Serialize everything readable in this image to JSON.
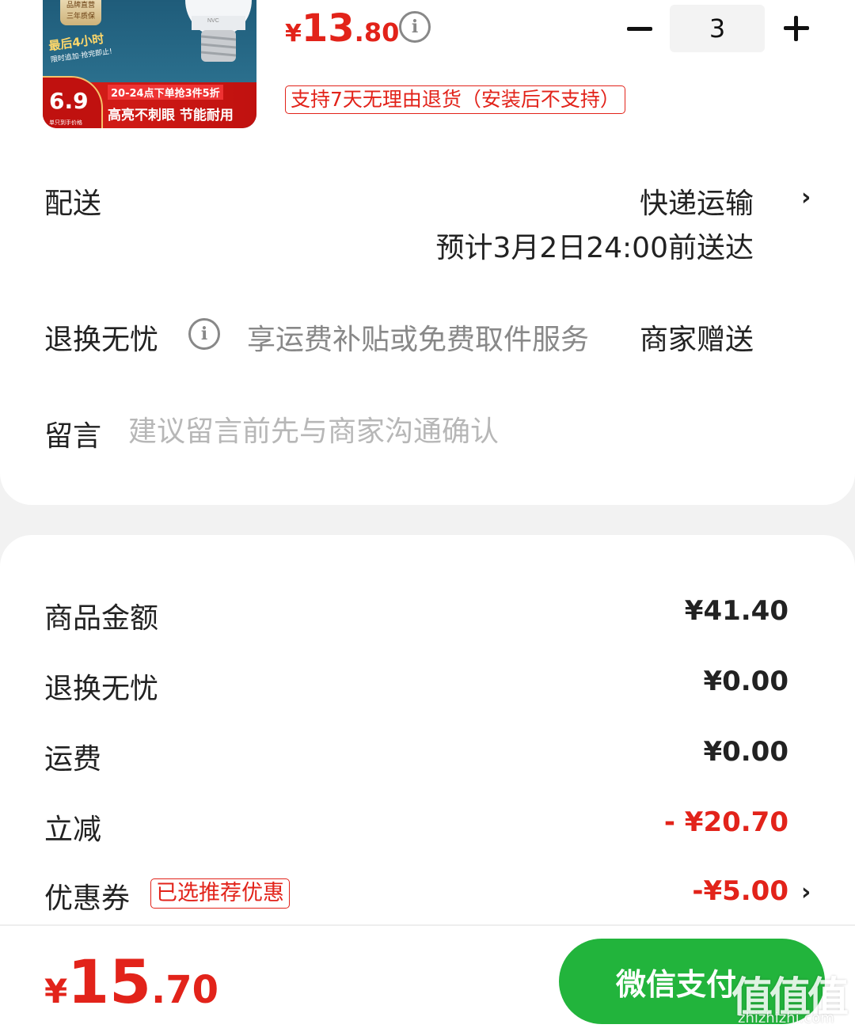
{
  "product": {
    "image": {
      "badge_line1": "品牌直营",
      "badge_line2": "三年质保",
      "countdown_title": "最后4小时",
      "countdown_sub": "限时追加·抢完即止!",
      "promo_price": "6.9",
      "promo_small": "单只到手价格",
      "promo_line1": "20-24点下单抢3件5折",
      "promo_line2": "高亮不刺眼 节能耐用",
      "brand_mark": "NVC"
    },
    "price": {
      "yen": "¥",
      "int": "13",
      "dec": ".80"
    },
    "quantity": "3",
    "return_tag": "支持7天无理由退货（安装后不支持）"
  },
  "delivery": {
    "label": "配送",
    "method": "快递运输",
    "eta": "预计3月2日24:00前送达"
  },
  "return_service": {
    "label": "退换无忧",
    "desc": "享运费补贴或免费取件服务",
    "gift": "商家赠送"
  },
  "message": {
    "label": "留言",
    "placeholder": "建议留言前先与商家沟通确认"
  },
  "summary": {
    "rows": [
      {
        "label": "商品金额",
        "value": "¥41.40"
      },
      {
        "label": "退换无忧",
        "value": "¥0.00"
      },
      {
        "label": "运费",
        "value": "¥0.00"
      },
      {
        "label": "立减",
        "value": "- ¥20.70"
      },
      {
        "label": "优惠券",
        "value": "-¥5.00"
      }
    ],
    "coupon_tag": "已选推荐优惠"
  },
  "footer": {
    "total": {
      "yen": "¥",
      "int": "15",
      "dec": ".70"
    },
    "pay_label": "微信支付"
  },
  "watermark": {
    "main": "值值值",
    "sub": "zhizhizhi.com"
  },
  "colors": {
    "accent_red": "#e2231a",
    "pay_green": "#22b43c",
    "muted": "#888888"
  }
}
